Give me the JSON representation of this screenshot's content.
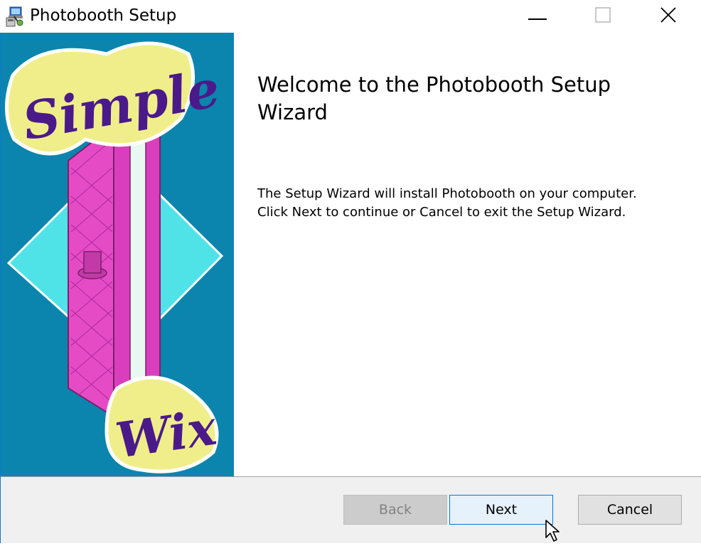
{
  "window": {
    "title": "Photobooth Setup",
    "icons": {
      "app": "installer-icon",
      "minimize": "minimize-icon",
      "maximize": "maximize-icon",
      "close": "close-icon"
    }
  },
  "banner": {
    "logo_top_text": "Simple",
    "logo_bottom_text": "Wix",
    "colors": {
      "background": "#0b85ad",
      "diamond": "#4fe3e8",
      "pink": "#e64bc6",
      "lettering_fill": "#f0ee8a",
      "lettering_text": "#4a1a8a"
    }
  },
  "content": {
    "heading": "Welcome to the Photobooth Setup Wizard",
    "body_line_1": "The Setup Wizard will install Photobooth on your computer.",
    "body_line_2": "Click Next to continue or Cancel to exit the Setup Wizard."
  },
  "footer": {
    "back_label": "Back",
    "next_label": "Next",
    "cancel_label": "Cancel",
    "accent": "#0078d7"
  }
}
